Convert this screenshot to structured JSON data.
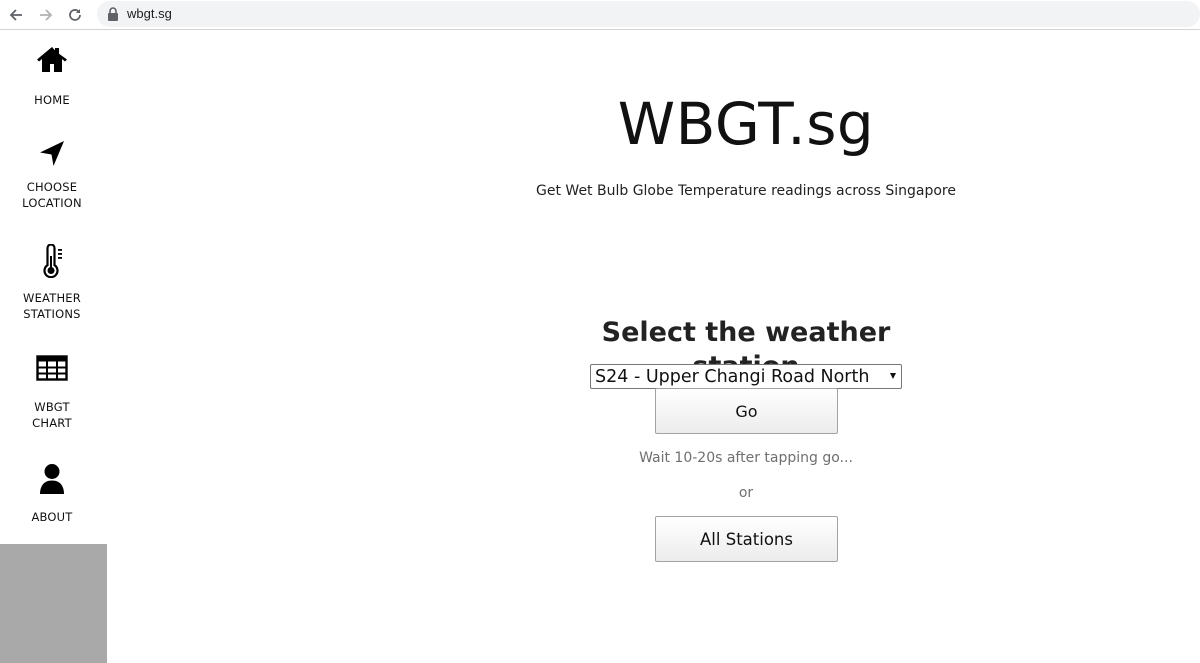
{
  "browser": {
    "url": "wbgt.sg",
    "icons": [
      "back-arrow-icon",
      "forward-arrow-icon",
      "reload-icon",
      "lock-icon"
    ]
  },
  "sidebar": {
    "items": [
      {
        "label": "HOME",
        "icon": "home-icon"
      },
      {
        "label": "CHOOSE\nLOCATION",
        "icon": "location-arrow-icon"
      },
      {
        "label": "WEATHER\nSTATIONS",
        "icon": "thermometer-icon"
      },
      {
        "label": "WBGT\nCHART",
        "icon": "table-grid-icon"
      },
      {
        "label": "ABOUT",
        "icon": "user-icon"
      }
    ],
    "filler_color": "#a9a9a9"
  },
  "main": {
    "title": "WBGT.sg",
    "subtitle": "Get Wet Bulb Globe Temperature readings across Singapore",
    "select_heading": "Select the weather station",
    "station_select": {
      "selected": "S24 - Upper Changi Road North"
    },
    "go_label": "Go",
    "wait_text": "Wait 10-20s after tapping go...",
    "or_text": "or",
    "all_stations_label": "All Stations"
  }
}
